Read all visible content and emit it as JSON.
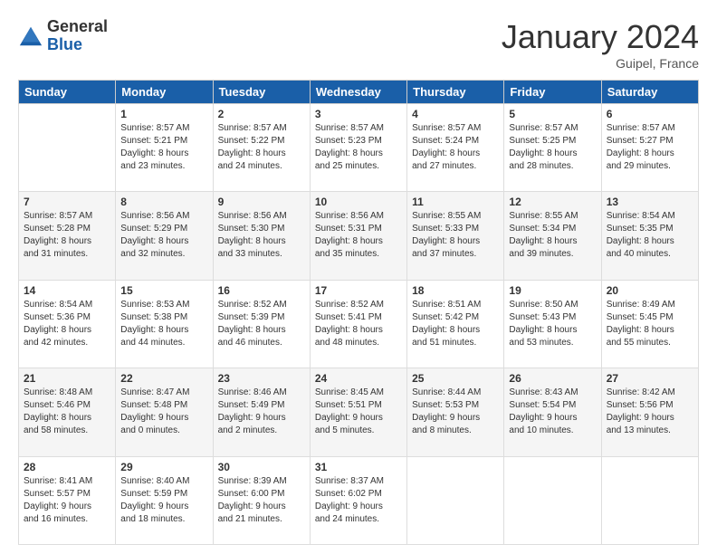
{
  "header": {
    "logo_general": "General",
    "logo_blue": "Blue",
    "title": "January 2024",
    "location": "Guipel, France"
  },
  "weekdays": [
    "Sunday",
    "Monday",
    "Tuesday",
    "Wednesday",
    "Thursday",
    "Friday",
    "Saturday"
  ],
  "weeks": [
    [
      {
        "day": "",
        "detail": ""
      },
      {
        "day": "1",
        "detail": "Sunrise: 8:57 AM\nSunset: 5:21 PM\nDaylight: 8 hours\nand 23 minutes."
      },
      {
        "day": "2",
        "detail": "Sunrise: 8:57 AM\nSunset: 5:22 PM\nDaylight: 8 hours\nand 24 minutes."
      },
      {
        "day": "3",
        "detail": "Sunrise: 8:57 AM\nSunset: 5:23 PM\nDaylight: 8 hours\nand 25 minutes."
      },
      {
        "day": "4",
        "detail": "Sunrise: 8:57 AM\nSunset: 5:24 PM\nDaylight: 8 hours\nand 27 minutes."
      },
      {
        "day": "5",
        "detail": "Sunrise: 8:57 AM\nSunset: 5:25 PM\nDaylight: 8 hours\nand 28 minutes."
      },
      {
        "day": "6",
        "detail": "Sunrise: 8:57 AM\nSunset: 5:27 PM\nDaylight: 8 hours\nand 29 minutes."
      }
    ],
    [
      {
        "day": "7",
        "detail": "Sunrise: 8:57 AM\nSunset: 5:28 PM\nDaylight: 8 hours\nand 31 minutes."
      },
      {
        "day": "8",
        "detail": "Sunrise: 8:56 AM\nSunset: 5:29 PM\nDaylight: 8 hours\nand 32 minutes."
      },
      {
        "day": "9",
        "detail": "Sunrise: 8:56 AM\nSunset: 5:30 PM\nDaylight: 8 hours\nand 33 minutes."
      },
      {
        "day": "10",
        "detail": "Sunrise: 8:56 AM\nSunset: 5:31 PM\nDaylight: 8 hours\nand 35 minutes."
      },
      {
        "day": "11",
        "detail": "Sunrise: 8:55 AM\nSunset: 5:33 PM\nDaylight: 8 hours\nand 37 minutes."
      },
      {
        "day": "12",
        "detail": "Sunrise: 8:55 AM\nSunset: 5:34 PM\nDaylight: 8 hours\nand 39 minutes."
      },
      {
        "day": "13",
        "detail": "Sunrise: 8:54 AM\nSunset: 5:35 PM\nDaylight: 8 hours\nand 40 minutes."
      }
    ],
    [
      {
        "day": "14",
        "detail": "Sunrise: 8:54 AM\nSunset: 5:36 PM\nDaylight: 8 hours\nand 42 minutes."
      },
      {
        "day": "15",
        "detail": "Sunrise: 8:53 AM\nSunset: 5:38 PM\nDaylight: 8 hours\nand 44 minutes."
      },
      {
        "day": "16",
        "detail": "Sunrise: 8:52 AM\nSunset: 5:39 PM\nDaylight: 8 hours\nand 46 minutes."
      },
      {
        "day": "17",
        "detail": "Sunrise: 8:52 AM\nSunset: 5:41 PM\nDaylight: 8 hours\nand 48 minutes."
      },
      {
        "day": "18",
        "detail": "Sunrise: 8:51 AM\nSunset: 5:42 PM\nDaylight: 8 hours\nand 51 minutes."
      },
      {
        "day": "19",
        "detail": "Sunrise: 8:50 AM\nSunset: 5:43 PM\nDaylight: 8 hours\nand 53 minutes."
      },
      {
        "day": "20",
        "detail": "Sunrise: 8:49 AM\nSunset: 5:45 PM\nDaylight: 8 hours\nand 55 minutes."
      }
    ],
    [
      {
        "day": "21",
        "detail": "Sunrise: 8:48 AM\nSunset: 5:46 PM\nDaylight: 8 hours\nand 58 minutes."
      },
      {
        "day": "22",
        "detail": "Sunrise: 8:47 AM\nSunset: 5:48 PM\nDaylight: 9 hours\nand 0 minutes."
      },
      {
        "day": "23",
        "detail": "Sunrise: 8:46 AM\nSunset: 5:49 PM\nDaylight: 9 hours\nand 2 minutes."
      },
      {
        "day": "24",
        "detail": "Sunrise: 8:45 AM\nSunset: 5:51 PM\nDaylight: 9 hours\nand 5 minutes."
      },
      {
        "day": "25",
        "detail": "Sunrise: 8:44 AM\nSunset: 5:53 PM\nDaylight: 9 hours\nand 8 minutes."
      },
      {
        "day": "26",
        "detail": "Sunrise: 8:43 AM\nSunset: 5:54 PM\nDaylight: 9 hours\nand 10 minutes."
      },
      {
        "day": "27",
        "detail": "Sunrise: 8:42 AM\nSunset: 5:56 PM\nDaylight: 9 hours\nand 13 minutes."
      }
    ],
    [
      {
        "day": "28",
        "detail": "Sunrise: 8:41 AM\nSunset: 5:57 PM\nDaylight: 9 hours\nand 16 minutes."
      },
      {
        "day": "29",
        "detail": "Sunrise: 8:40 AM\nSunset: 5:59 PM\nDaylight: 9 hours\nand 18 minutes."
      },
      {
        "day": "30",
        "detail": "Sunrise: 8:39 AM\nSunset: 6:00 PM\nDaylight: 9 hours\nand 21 minutes."
      },
      {
        "day": "31",
        "detail": "Sunrise: 8:37 AM\nSunset: 6:02 PM\nDaylight: 9 hours\nand 24 minutes."
      },
      {
        "day": "",
        "detail": ""
      },
      {
        "day": "",
        "detail": ""
      },
      {
        "day": "",
        "detail": ""
      }
    ]
  ]
}
